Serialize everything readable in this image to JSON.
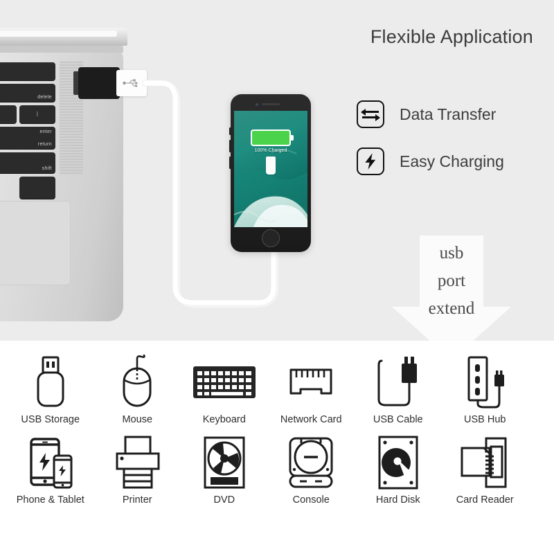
{
  "hero": {
    "title": "Flexible Application",
    "background_color": "#ececec",
    "features": [
      {
        "label": "Data Transfer",
        "icon": "data-transfer-arrows-icon"
      },
      {
        "label": "Easy Charging",
        "icon": "lightning-bolt-icon"
      }
    ],
    "callout": {
      "lines": [
        "usb",
        "port",
        "extend"
      ],
      "shape": "down-arrow",
      "color": "#fbfbfb"
    },
    "laptop": {
      "keys": [
        {
          "label": "+",
          "sub": "="
        },
        {
          "label": "delete"
        },
        {
          "label": "}"
        },
        {
          "label": "|"
        },
        {
          "label": "enter",
          "sub": "return"
        },
        {
          "label": "shift"
        }
      ]
    },
    "phone": {
      "battery_status": "100% Charged",
      "battery_level": 100,
      "battery_color": "#4cd34c",
      "wallpaper": "ocean-wave"
    },
    "connector": {
      "adapter_color": "#1c1c1c",
      "plug_logo": "usb-trident-icon",
      "cable_color": "#ffffff"
    }
  },
  "grid": {
    "background_color": "#ffffff",
    "rows": [
      [
        {
          "label": "USB Storage",
          "icon": "usb-flash-drive-icon"
        },
        {
          "label": "Mouse",
          "icon": "mouse-icon"
        },
        {
          "label": "Keyboard",
          "icon": "keyboard-icon"
        },
        {
          "label": "Network Card",
          "icon": "network-card-icon"
        },
        {
          "label": "USB Cable",
          "icon": "usb-cable-icon"
        },
        {
          "label": "USB Hub",
          "icon": "usb-hub-icon"
        }
      ],
      [
        {
          "label": "Phone & Tablet",
          "icon": "phone-tablet-icon"
        },
        {
          "label": "Printer",
          "icon": "printer-icon"
        },
        {
          "label": "DVD",
          "icon": "dvd-drive-icon"
        },
        {
          "label": "Console",
          "icon": "console-icon"
        },
        {
          "label": "Hard Disk",
          "icon": "hard-disk-icon"
        },
        {
          "label": "Card Reader",
          "icon": "card-reader-icon"
        }
      ]
    ]
  }
}
